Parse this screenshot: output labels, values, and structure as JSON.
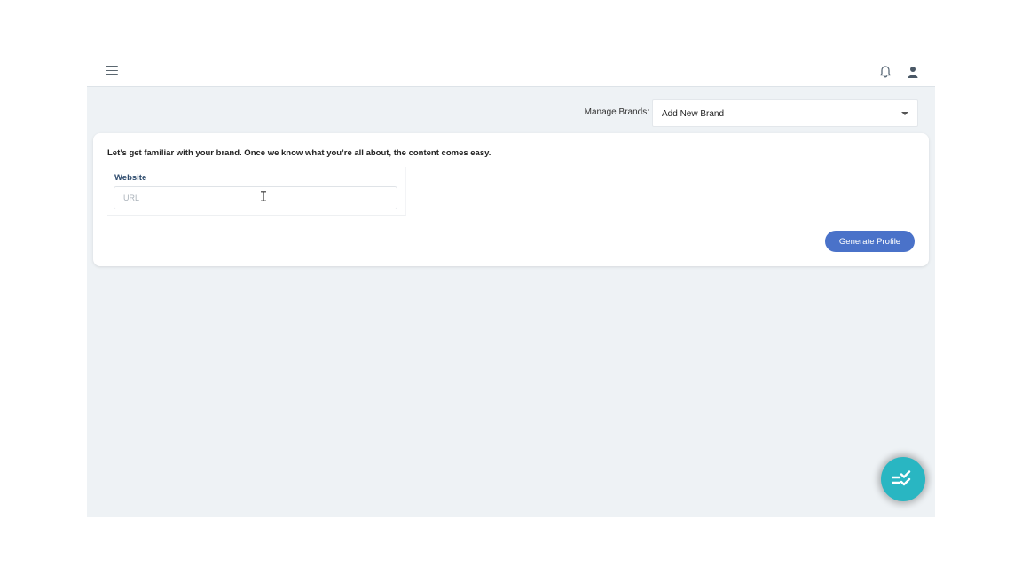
{
  "header": {
    "menu_icon": "hamburger-menu-icon",
    "notification_icon": "bell-icon",
    "profile_icon": "user-icon"
  },
  "brands": {
    "label": "Manage Brands:",
    "selected": "Add New Brand"
  },
  "card": {
    "intro": "Let’s get familiar with your brand. Once we know what you’re all about, the content comes easy.",
    "website_label": "Website",
    "url_placeholder": "URL",
    "url_value": "",
    "generate_button": "Generate Profile"
  },
  "fab": {
    "icon": "checklist-icon"
  },
  "colors": {
    "accent": "#4a72c9",
    "fab": "#29b6c2",
    "app_background": "#eef2f5"
  }
}
